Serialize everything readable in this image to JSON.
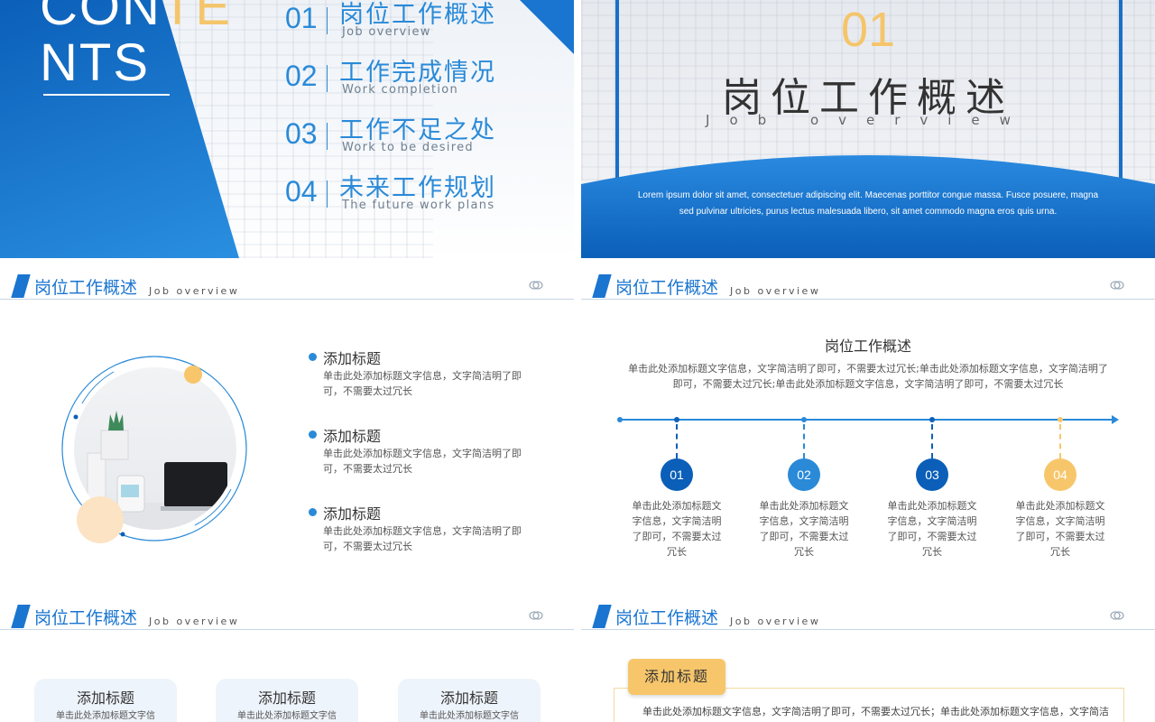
{
  "contents": {
    "title_line1_a": "CON",
    "title_line1_b": "TE",
    "title_line2": "NTS",
    "items": [
      {
        "num": "01",
        "title": "岗位工作概述",
        "sub": "Job overview"
      },
      {
        "num": "02",
        "title": "工作完成情况",
        "sub": "Work completion"
      },
      {
        "num": "03",
        "title": "工作不足之处",
        "sub": "Work to be desired"
      },
      {
        "num": "04",
        "title": "未来工作规划",
        "sub": "The future work plans"
      }
    ]
  },
  "section_cover": {
    "num": "01",
    "title": "岗位工作概述",
    "sub": "Job overview",
    "lorem": "Lorem ipsum dolor sit amet, consectetuer adipiscing elit. Maecenas porttitor congue massa. Fusce posuere, magna sed pulvinar ultricies, purus lectus malesuada libero, sit amet commodo magna eros quis urna."
  },
  "header": {
    "title": "岗位工作概述",
    "sub": "Job overview"
  },
  "bullets": [
    {
      "title": "添加标题",
      "text": "单击此处添加标题文字信息，文字简洁明了即可，不需要太过冗长"
    },
    {
      "title": "添加标题",
      "text": "单击此处添加标题文字信息，文字简洁明了即可，不需要太过冗长"
    },
    {
      "title": "添加标题",
      "text": "单击此处添加标题文字信息，文字简洁明了即可，不需要太过冗长"
    }
  ],
  "timeline": {
    "title": "岗位工作概述",
    "desc": "单击此处添加标题文字信息，文字简洁明了即可，不需要太过冗长;单击此处添加标题文字信息，文字简洁明了即可，不需要太过冗长;单击此处添加标题文字信息，文字简洁明了即可，不需要太过冗长",
    "steps": [
      {
        "num": "01",
        "text": "单击此处添加标题文字信息，文字简洁明了即可，不需要太过冗长",
        "color": "#0b5fb8"
      },
      {
        "num": "02",
        "text": "单击此处添加标题文字信息，文字简洁明了即可，不需要太过冗长",
        "color": "#2a8ad8"
      },
      {
        "num": "03",
        "text": "单击此处添加标题文字信息，文字简洁明了即可，不需要太过冗长",
        "color": "#0b5fb8"
      },
      {
        "num": "04",
        "text": "单击此处添加标题文字信息，文字简洁明了即可，不需要太过冗长",
        "color": "#f7c66b"
      }
    ]
  },
  "cards": [
    {
      "title": "添加标题",
      "text": "单击此处添加标题文字信"
    },
    {
      "title": "添加标题",
      "text": "单击此处添加标题文字信"
    },
    {
      "title": "添加标题",
      "text": "单击此处添加标题文字信"
    }
  ],
  "tag_block": {
    "tag": "添加标题",
    "text": "单击此处添加标题文字信息，文字简洁明了即可，不需要太过冗长；单击此处添加标题文字信息，文字简洁"
  },
  "colors": {
    "primary": "#1a75d0",
    "accent": "#f7c66b",
    "light": "#2a8ad8"
  }
}
